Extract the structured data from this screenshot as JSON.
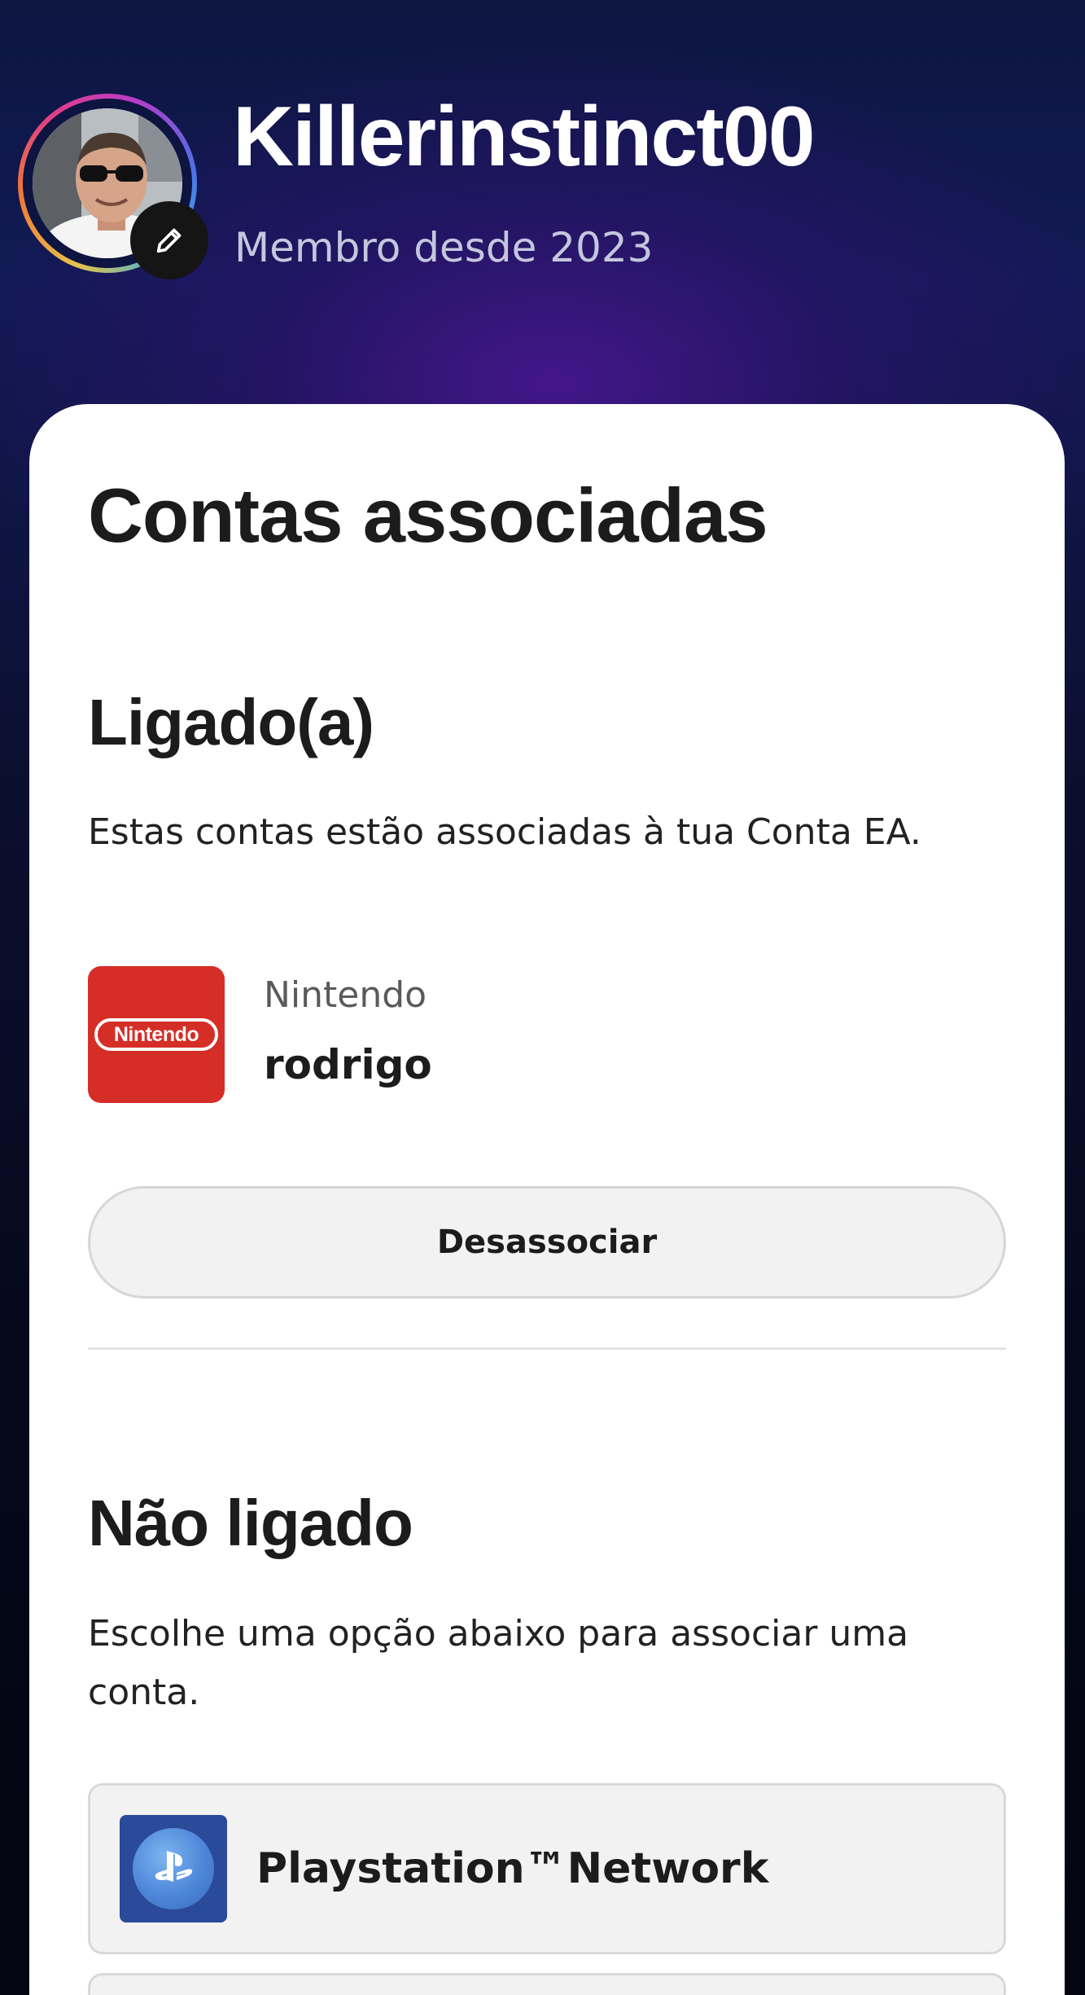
{
  "profile": {
    "username": "Killerinstinct00",
    "member_since": "Membro desde 2023",
    "avatar_icon": "user-photo",
    "edit_icon": "pencil-icon",
    "ring_colors": [
      "#e7c24a",
      "#f07b36",
      "#e23e86",
      "#b83cc9",
      "#4d6fe6",
      "#3db1e0"
    ]
  },
  "linked_accounts": {
    "title": "Contas associadas",
    "connected": {
      "heading": "Ligado(a)",
      "description": "Estas contas estão associadas à tua Conta EA.",
      "accounts": [
        {
          "platform": "Nintendo",
          "logo_text": "Nintendo",
          "logo_color": "#d52e27",
          "username": "rodrigo",
          "unlink_label": "Desassociar"
        }
      ]
    },
    "not_connected": {
      "heading": "Não ligado",
      "description": "Escolhe uma opção abaixo para associar uma conta.",
      "options": [
        {
          "label": "Playstation™Network",
          "icon": "playstation-icon",
          "logo_color": "#2b4a99"
        }
      ]
    }
  }
}
